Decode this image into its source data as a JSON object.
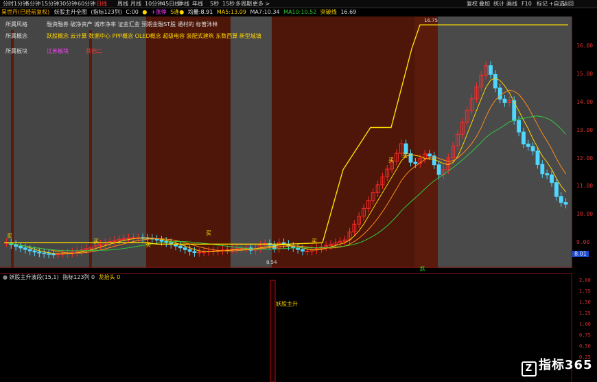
{
  "toolbar": {
    "items": [
      "分时",
      "1分钟",
      "5分钟",
      "15分钟",
      "30分钟",
      "60分钟",
      "日线",
      "周线",
      "月线",
      "10分钟",
      "45日线",
      "季线",
      "年线",
      "5秒",
      "15秒",
      "多周期",
      "更多 >"
    ],
    "active_index": 6,
    "right_items": [
      "复权",
      "叠加",
      "统计",
      "画线",
      "F10",
      "标记",
      "+自选",
      "返回"
    ]
  },
  "info": {
    "stock": "昊世丹(已经前复权)",
    "formula": "妖股主升全图",
    "count": "(指标123列)",
    "c_label": "C:00",
    "n_label": "●",
    "gain_label": "+涨停",
    "gain2": "●涨停●",
    "s_label": "S逢●",
    "ma_label": "均量:8.91",
    "ma5": "MA5:13.09",
    "ma7": "MA7:10.34",
    "ma10": "MA10:10.52",
    "trend": "突破线",
    "trend_val": "16.69"
  },
  "meta": {
    "row1_label": "所属风格",
    "row1_value": "融资融券 破净资产 城市净率 证金汇金 预期金融ST股 通村的 标普沐林",
    "row2_label": "所属概念",
    "row2_value": "跃股概念 云计算 数据中心 PPP概念 OLED概念 超级电容 装配式建筑 东数西算 新型城镇",
    "row3_label": "所属板块",
    "row3_value1": "江苏板块",
    "row3_value2": "其他二"
  },
  "main_axis": {
    "labels": [
      "16.00",
      "15.00",
      "14.00",
      "13.00",
      "12.00",
      "11.00",
      "10.00",
      "9.00"
    ],
    "current": "8.01"
  },
  "annotations": {
    "low_price": "8.54",
    "high_price": "16.75",
    "buy_labels": [
      "买",
      "买",
      "买",
      "买",
      "买",
      "买",
      "买"
    ],
    "bottom_marker": "跌"
  },
  "sub": {
    "title": "妖股主升波段(15,1)",
    "count": "指标123列 0",
    "dragon": "龙抬头 0",
    "signal": "妖股主升",
    "axis": [
      "2.00",
      "1.75",
      "1.50",
      "1.25",
      "1.00",
      "0.75",
      "0.50",
      "0.25"
    ]
  },
  "watermark": "指标365",
  "chart_data": {
    "type": "candlestick",
    "x_count": 120,
    "ylim": [
      8.2,
      16.9
    ],
    "ma_lines": [
      "MA5",
      "MA7",
      "MA10",
      "突破线"
    ]
  }
}
